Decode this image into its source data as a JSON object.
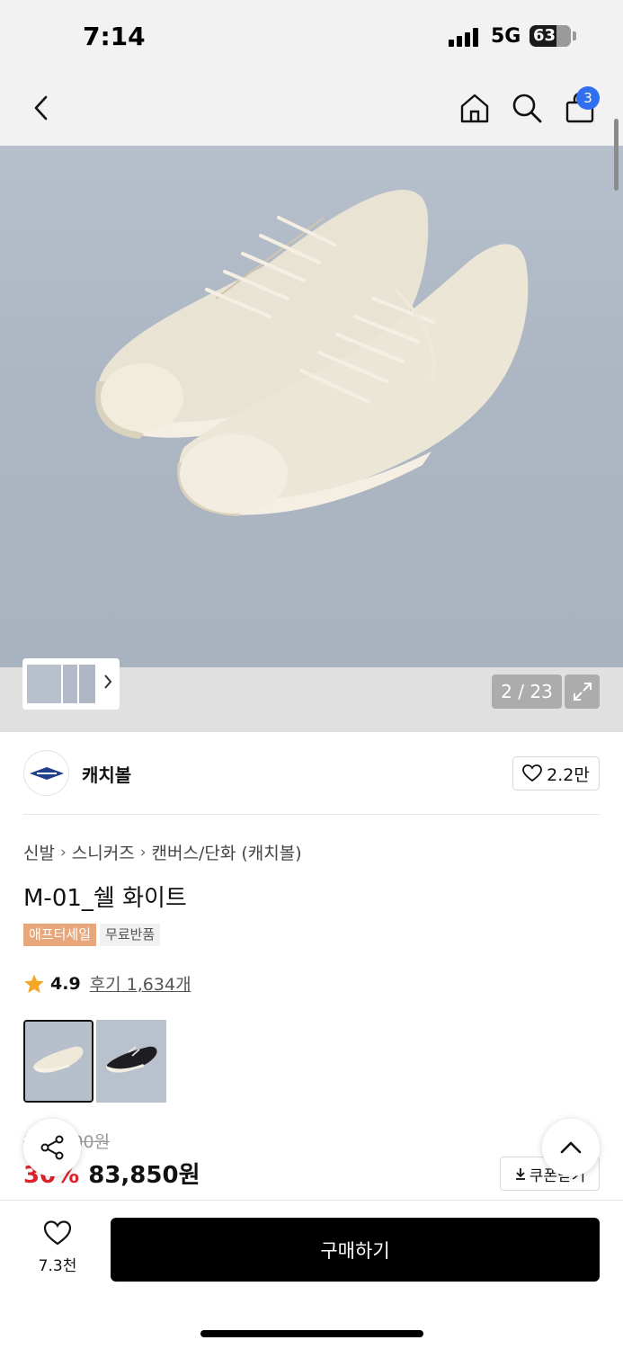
{
  "status_bar": {
    "time": "7:14",
    "network": "5G",
    "battery": "63"
  },
  "nav": {
    "cart_count": "3",
    "icons": [
      "back-icon",
      "home-icon",
      "search-icon",
      "cart-icon"
    ]
  },
  "gallery": {
    "counter": "2 / 23"
  },
  "brand": {
    "name": "캐치볼",
    "likes": "2.2만"
  },
  "product": {
    "breadcrumb": [
      "신발",
      "스니커즈",
      "캔버스/단화 (캐치볼)"
    ],
    "title": "M-01_쉘 화이트",
    "tags": [
      "애프터세일",
      "무료반품"
    ],
    "rating": "4.9",
    "reviews": "후기 1,634개",
    "original_price": "119,800원",
    "discount": "30%",
    "price": "83,850원",
    "coupon_label": "쿠폰받기"
  },
  "bottom_bar": {
    "wish_count": "7.3천",
    "buy_label": "구매하기"
  },
  "colors": {
    "brand_accent": "#2f6ff0",
    "discount_red": "#e0232a",
    "sale_tag": "#e8a77a"
  }
}
